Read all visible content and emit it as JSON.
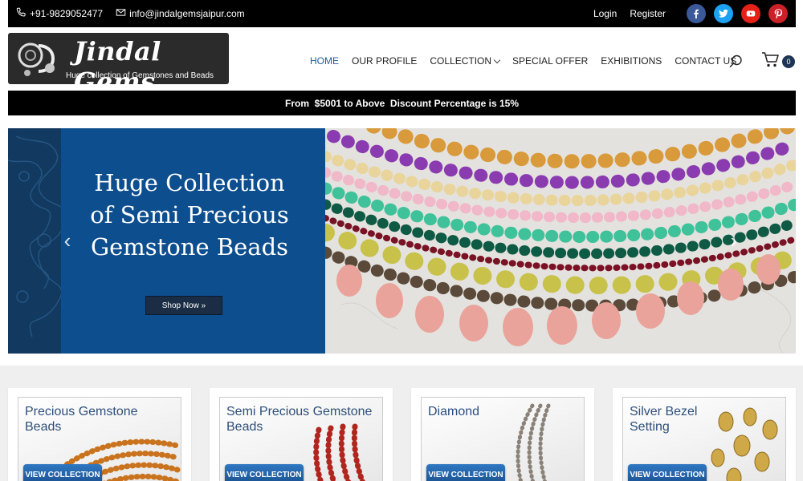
{
  "topbar": {
    "phone": "+91-9829052477",
    "email": "info@jindalgemsjaipur.com",
    "login": "Login",
    "register": "Register",
    "social": [
      {
        "icon": "facebook-icon",
        "color": "#3b5998"
      },
      {
        "icon": "twitter-icon",
        "color": "#1da1f2"
      },
      {
        "icon": "youtube-icon",
        "color": "#e62117"
      },
      {
        "icon": "pinterest-icon",
        "color": "#cb2027"
      }
    ]
  },
  "logo": {
    "brand": "Jindal Gems",
    "tagline": "Huge collection of Gemstones and Beads"
  },
  "nav": {
    "items": [
      "HOME",
      "OUR PROFILE",
      "COLLECTION",
      "SPECIAL OFFER",
      "EXHIBITIONS",
      "CONTACT US"
    ],
    "active": "HOME"
  },
  "cart": {
    "count": "0"
  },
  "promo": {
    "text": "From  $5001 to Above  Discount Percentage is 15%"
  },
  "hero": {
    "title": "Huge Collection of Semi Precious Gemstone Beads",
    "button": "Shop Now »"
  },
  "categories": [
    {
      "title": "Precious Gemstone Beads",
      "button": "VIEW COLLECTION"
    },
    {
      "title": "Semi Precious Gemstone Beads",
      "button": "VIEW COLLECTION"
    },
    {
      "title": "Diamond",
      "button": "VIEW COLLECTION"
    },
    {
      "title": "Silver Bezel Setting",
      "button": "VIEW COLLECTION"
    }
  ],
  "colors": {
    "accent": "#1f5aa8",
    "hero_blue": "#0d4e8f",
    "topbar": "#000000"
  }
}
